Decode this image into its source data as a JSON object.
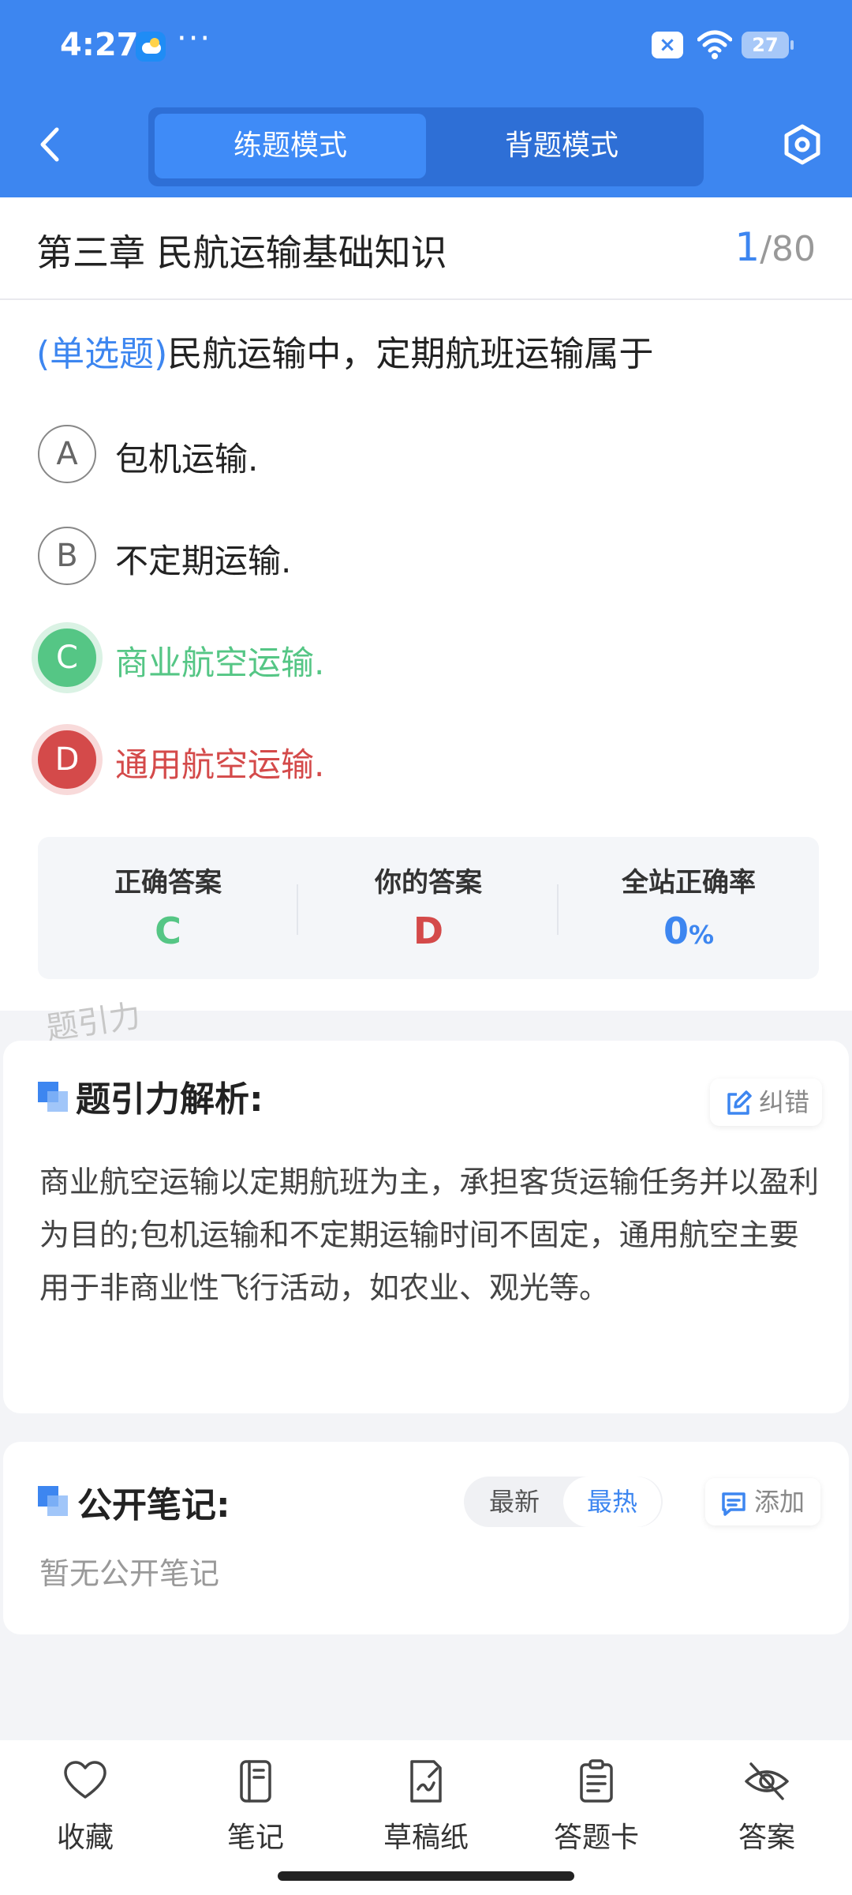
{
  "status_bar": {
    "time": "4:27",
    "dots": "···",
    "battery": "27"
  },
  "nav": {
    "tabs": [
      {
        "label": "练题模式",
        "active": true
      },
      {
        "label": "背题模式",
        "active": false
      }
    ]
  },
  "chapter": {
    "title": "第三章 民航运输基础知识",
    "current": "1",
    "total": "/80"
  },
  "question": {
    "type_label": "(单选题)",
    "text": "民航运输中，定期航班运输属于",
    "options": [
      {
        "letter": "A",
        "text": "包机运输.",
        "state": "normal"
      },
      {
        "letter": "B",
        "text": "不定期运输.",
        "state": "normal"
      },
      {
        "letter": "C",
        "text": "商业航空运输.",
        "state": "correct"
      },
      {
        "letter": "D",
        "text": "通用航空运输.",
        "state": "wrong"
      }
    ]
  },
  "answer_summary": {
    "correct_label": "正确答案",
    "correct_value": "C",
    "yours_label": "你的答案",
    "yours_value": "D",
    "rate_label": "全站正确率",
    "rate_value": "0",
    "rate_unit": "%"
  },
  "watermark": "题引力",
  "analysis": {
    "title": "题引力解析:",
    "report_label": "纠错",
    "body": "商业航空运输以定期航班为主，承担客货运输任务并以盈利为目的;包机运输和不定期运输时间不固定，通用航空主要用于非商业性飞行活动，如农业、观光等。"
  },
  "notes": {
    "title": "公开笔记:",
    "sort_options": [
      "最新",
      "最热"
    ],
    "active_sort": "最热",
    "add_label": "添加",
    "empty_text": "暂无公开笔记"
  },
  "bottom_bar": {
    "items": [
      {
        "label": "收藏",
        "icon": "heart-icon"
      },
      {
        "label": "笔记",
        "icon": "notebook-icon"
      },
      {
        "label": "草稿纸",
        "icon": "draft-paper-icon"
      },
      {
        "label": "答题卡",
        "icon": "answer-sheet-icon"
      },
      {
        "label": "答案",
        "icon": "eye-off-icon"
      }
    ]
  },
  "colors": {
    "primary": "#3d86f0",
    "correct": "#55c685",
    "wrong": "#d44a4a"
  }
}
